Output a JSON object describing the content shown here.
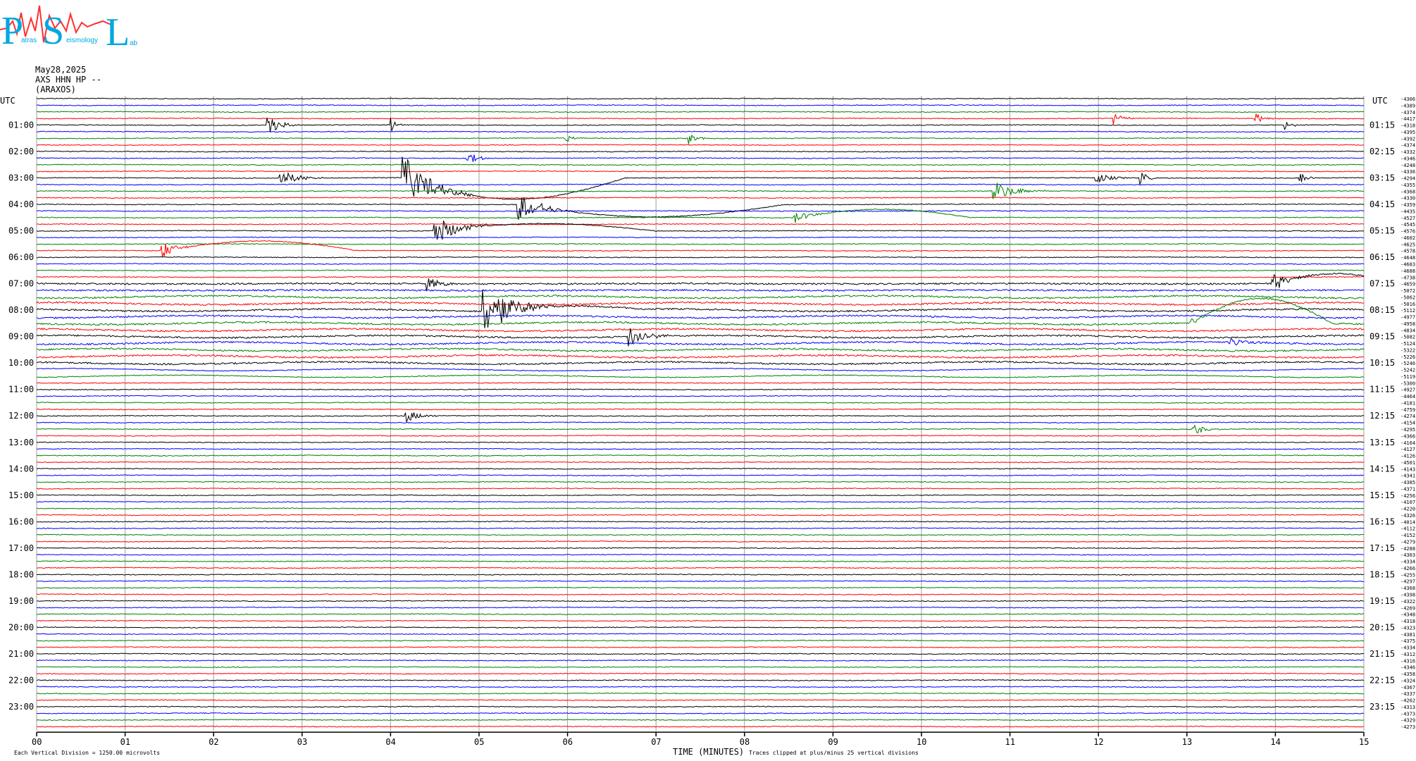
{
  "header": {
    "date": "May28,2025",
    "station": "AXS HHN HP --",
    "site": "(ARAXOS)"
  },
  "logo": {
    "letters": [
      "P",
      "S",
      "L"
    ],
    "words": [
      "atras",
      "eismology",
      "ab"
    ]
  },
  "colors": {
    "trace_cycle": [
      "#000000",
      "#0000ff",
      "#008000",
      "#ff0000"
    ],
    "grid": "#a0a0a0",
    "logo_text": "#00a8e0",
    "logo_wave": "#ff3030"
  },
  "chart_data": {
    "type": "line",
    "title": "",
    "xlabel": "TIME (MINUTES)",
    "ylabel": "",
    "x_ticks": [
      "00",
      "01",
      "02",
      "03",
      "04",
      "05",
      "06",
      "07",
      "08",
      "09",
      "10",
      "11",
      "12",
      "13",
      "14",
      "15"
    ],
    "xlim": [
      0,
      15
    ],
    "left_axis_label": "UTC",
    "right_axis_label": "UTC",
    "left_hour_labels": [
      "01:00",
      "02:00",
      "03:00",
      "04:00",
      "05:00",
      "06:00",
      "07:00",
      "08:00",
      "09:00",
      "10:00",
      "11:00",
      "12:00",
      "13:00",
      "14:00",
      "15:00",
      "16:00",
      "17:00",
      "18:00",
      "19:00",
      "20:00",
      "21:00",
      "22:00",
      "23:00"
    ],
    "right_hour_labels": [
      "01:15",
      "02:15",
      "03:15",
      "04:15",
      "05:15",
      "06:15",
      "07:15",
      "08:15",
      "09:15",
      "10:15",
      "11:15",
      "12:15",
      "13:15",
      "14:15",
      "15:15",
      "16:15",
      "17:15",
      "18:15",
      "19:15",
      "20:15",
      "21:15",
      "22:15",
      "23:15"
    ],
    "trace_count": 96,
    "trace_minutes": 15,
    "trace_offsets": [
      "-4306",
      "-4389",
      "-4374",
      "-4417",
      "-4318",
      "-4395",
      "-4392",
      "-4374",
      "-4332",
      "-4346",
      "-4248",
      "-4336",
      "-4294",
      "-4355",
      "-4368",
      "-4330",
      "-4359",
      "-4435",
      "-4527",
      "-4545",
      "-4576",
      "-4602",
      "-4625",
      "-4578",
      "-4648",
      "-4683",
      "-4688",
      "-4738",
      "-4659",
      "-5072",
      "-5062",
      "-5016",
      "-5112",
      "-4977",
      "-4958",
      "-4834",
      "-5082",
      "-5124",
      "-5322",
      "-5226",
      "-5246",
      "-5242",
      "-5119",
      "-5300",
      "-4927",
      "-4464",
      "-4181",
      "-4759",
      "-4274",
      "-4154",
      "-4295",
      "-4366",
      "-4164",
      "-4127",
      "-4126",
      "-4501",
      "-4143",
      "-4341",
      "-4385",
      "-4371",
      "-4256",
      "-4107",
      "-4220",
      "-4326",
      "-4014",
      "-4112",
      "-4152",
      "-4279",
      "-4288",
      "-4303",
      "-4334",
      "-4266",
      "-4255",
      "-4297",
      "-4368",
      "-4398",
      "-4322",
      "-4269",
      "-4348",
      "-4318",
      "-4323",
      "-4381",
      "-4375",
      "-4334",
      "-4312",
      "-4316",
      "-4346",
      "-4358",
      "-4324",
      "-4367",
      "-4337",
      "-4262",
      "-4313",
      "-4373",
      "-4329",
      "-4273"
    ],
    "events": [
      {
        "trace": 3,
        "minute": 12.18,
        "amplitude": 8,
        "duration": 0.25
      },
      {
        "trace": 3,
        "minute": 13.78,
        "amplitude": 7,
        "duration": 0.3
      },
      {
        "trace": 4,
        "minute": 2.62,
        "amplitude": 14,
        "duration": 0.35
      },
      {
        "trace": 4,
        "minute": 4.02,
        "amplitude": 8,
        "duration": 0.15
      },
      {
        "trace": 4,
        "minute": 14.12,
        "amplitude": 6,
        "duration": 0.2
      },
      {
        "trace": 6,
        "minute": 5.98,
        "amplitude": 6,
        "duration": 0.2
      },
      {
        "trace": 6,
        "minute": 7.38,
        "amplitude": 7,
        "duration": 0.25
      },
      {
        "trace": 9,
        "minute": 4.88,
        "amplitude": 9,
        "duration": 0.3
      },
      {
        "trace": 12,
        "minute": 2.75,
        "amplitude": 12,
        "duration": 0.5
      },
      {
        "trace": 12,
        "minute": 4.15,
        "amplitude": 34,
        "duration": 0.8,
        "swing": 30,
        "swing_minutes": 2.5
      },
      {
        "trace": 12,
        "minute": 11.98,
        "amplitude": 9,
        "duration": 0.35
      },
      {
        "trace": 12,
        "minute": 12.48,
        "amplitude": 9,
        "duration": 0.2
      },
      {
        "trace": 12,
        "minute": 14.28,
        "amplitude": 8,
        "duration": 0.2
      },
      {
        "trace": 14,
        "minute": 10.82,
        "amplitude": 14,
        "duration": 0.6
      },
      {
        "trace": 16,
        "minute": 5.45,
        "amplitude": 22,
        "duration": 0.6,
        "swing": 18,
        "swing_minutes": 3
      },
      {
        "trace": 18,
        "minute": 8.55,
        "amplitude": 10,
        "duration": 0.4,
        "swing": -12,
        "swing_minutes": 2
      },
      {
        "trace": 20,
        "minute": 4.5,
        "amplitude": 22,
        "duration": 0.6,
        "swing": -10,
        "swing_minutes": 2.5
      },
      {
        "trace": 23,
        "minute": 1.42,
        "amplitude": 12,
        "duration": 0.4,
        "swing": -14,
        "swing_minutes": 2.2
      },
      {
        "trace": 28,
        "minute": 4.42,
        "amplitude": 9,
        "duration": 0.4
      },
      {
        "trace": 28,
        "minute": 13.98,
        "amplitude": 14,
        "duration": 0.4,
        "swing": -14,
        "swing_minutes": 1.4
      },
      {
        "trace": 32,
        "minute": 5.05,
        "amplitude": 40,
        "duration": 0.8,
        "swing": -6,
        "swing_minutes": 1.8
      },
      {
        "trace": 34,
        "minute": 13.05,
        "amplitude": 6,
        "duration": 0.2,
        "swing": -34,
        "swing_minutes": 1.6
      },
      {
        "trace": 36,
        "minute": 6.7,
        "amplitude": 16,
        "duration": 0.45
      },
      {
        "trace": 37,
        "minute": 13.5,
        "amplitude": 6,
        "duration": 0.5
      },
      {
        "trace": 48,
        "minute": 4.18,
        "amplitude": 9,
        "duration": 0.4
      },
      {
        "trace": 50,
        "minute": 13.08,
        "amplitude": 9,
        "duration": 0.3
      }
    ],
    "footer_left_text": "Each Vertical Division = 1250.00 microvolts",
    "footer_right_text": "Traces clipped at plus/minus 25 vertical divisions"
  }
}
